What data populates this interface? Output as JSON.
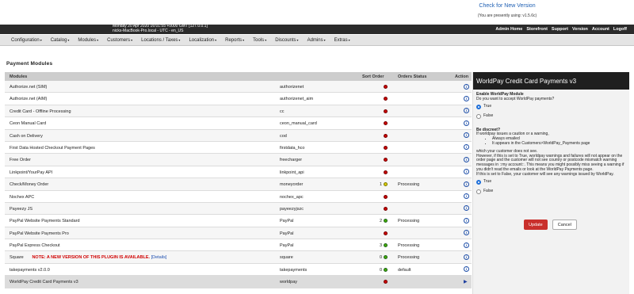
{
  "top": {
    "check_link": "Check for New Version",
    "using": "(You are presently using: v1.5.6c)"
  },
  "header": {
    "datetime": "Monday 20 Apr 2020 16:01:55 +0000 GMT [127.0.0.1]",
    "host": "nicks-MacBook-Pro.local - UTC - en_US",
    "admin_links": [
      "Admin Home",
      "Storefront",
      "Support",
      "Version",
      "Account",
      "Logoff"
    ]
  },
  "menu": [
    "Configuration",
    "Catalog",
    "Modules",
    "Customers",
    "Locations / Taxes",
    "Localization",
    "Reports",
    "Tools",
    "Discounts",
    "Admins",
    "Extras"
  ],
  "page_title": "Payment Modules",
  "table": {
    "headers": {
      "modules": "Modules",
      "sort": "Sort Order",
      "status": "Orders Status",
      "action": "Action"
    },
    "rows": [
      {
        "name": "Authorize.net (SIM)",
        "code": "authorizenet",
        "sort": "",
        "dot": "red",
        "status": ""
      },
      {
        "name": "Authorize.net (AIM)",
        "code": "authorizenet_aim",
        "sort": "",
        "dot": "red",
        "status": ""
      },
      {
        "name": "Credit Card - Offline Processing",
        "code": "cc",
        "sort": "",
        "dot": "red",
        "status": ""
      },
      {
        "name": "Ceon Manual Card",
        "code": "ceon_manual_card",
        "sort": "",
        "dot": "red",
        "status": ""
      },
      {
        "name": "Cash on Delivery",
        "code": "cod",
        "sort": "",
        "dot": "red",
        "status": ""
      },
      {
        "name": "First Data Hosted Checkout Payment Pages",
        "code": "firstdata_hco",
        "sort": "",
        "dot": "red",
        "status": ""
      },
      {
        "name": "Free Order",
        "code": "freecharger",
        "sort": "",
        "dot": "red",
        "status": ""
      },
      {
        "name": "Linkpoint/YourPay API",
        "code": "linkpoint_api",
        "sort": "",
        "dot": "red",
        "status": ""
      },
      {
        "name": "Check/Money Order",
        "code": "moneyorder",
        "sort": "1",
        "dot": "yellow",
        "status": "Processing"
      },
      {
        "name": "Nochex APC",
        "code": "nochex_apc",
        "sort": "",
        "dot": "red",
        "status": ""
      },
      {
        "name": "Payeezy JS",
        "code": "payeezyjszc",
        "sort": "",
        "dot": "red",
        "status": ""
      },
      {
        "name": "PayPal Website Payments Standard",
        "code": "PayPal",
        "sort": "2",
        "dot": "green",
        "status": "Processing"
      },
      {
        "name": "PayPal Website Payments Pro",
        "code": "PayPal",
        "sort": "",
        "dot": "red",
        "status": ""
      },
      {
        "name": "PayPal Express Checkout",
        "code": "PayPal",
        "sort": "3",
        "dot": "green",
        "status": "Processing"
      },
      {
        "name": "Square",
        "note": "NOTE: A NEW VERSION OF THIS PLUGIN IS AVAILABLE.",
        "details": "[Details]",
        "code": "square",
        "sort": "0",
        "dot": "green",
        "status": "Processing"
      },
      {
        "name": "takepayments v2.0.0",
        "code": "takepayments",
        "sort": "0",
        "dot": "green",
        "status": "default"
      },
      {
        "name": "WorldPay Credit Card Payments v3",
        "code": "worldpay",
        "sort": "",
        "dot": "red",
        "status": "",
        "selected": true
      }
    ]
  },
  "panel": {
    "title": "WorldPay Credit Card Payments v3",
    "enable_label": "Enable WorldPay Module",
    "enable_q": "Do you want to accept WorldPay payments?",
    "opt_true": "True",
    "opt_false": "False",
    "discreet_label": "Be discreet?",
    "discreet_intro": "If worldpay issues a caution or a warning,",
    "bullets": [
      "Always emailed",
      "It appears in the Customers>WorldPay_Payments page"
    ],
    "discreet_p1": "which your customer does not see.",
    "discreet_p2": "However, if this is set to True, worldpay warnings and failures will not appear on the order page and the customer will not see country or postcode mismatch warning messages in ::my account::. This means you might possibly miss seeing a warning if you didn't read the emails or look at the WorldPay Payments page.",
    "discreet_p3": "If this is set to False, your customer will see any warnings issued by WorldPay.",
    "update": "Update",
    "cancel": "Cancel"
  }
}
